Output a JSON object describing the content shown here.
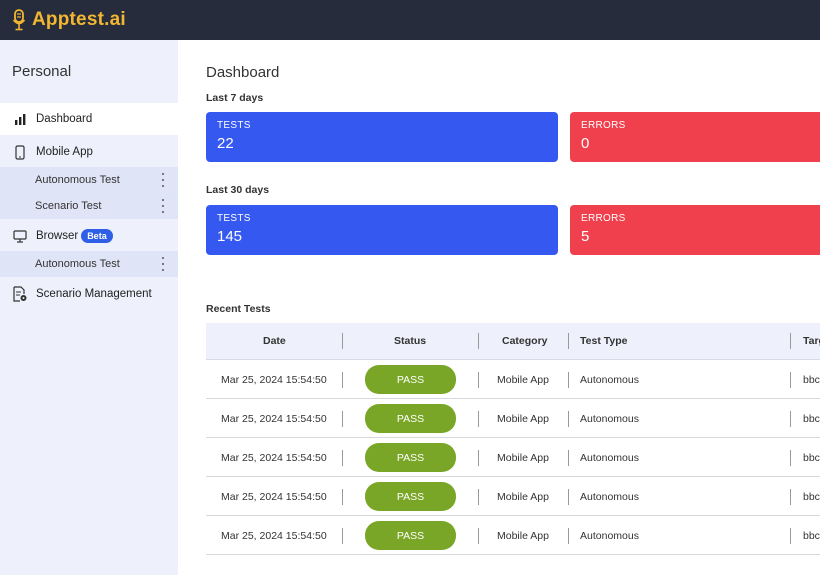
{
  "app": {
    "name": "Apptest.ai"
  },
  "sidebar": {
    "section_title": "Personal",
    "dashboard": "Dashboard",
    "mobile_app": "Mobile App",
    "mobile_sub": [
      "Autonomous Test",
      "Scenario Test"
    ],
    "browser": "Browser",
    "browser_badge": "Beta",
    "browser_sub": [
      "Autonomous Test"
    ],
    "scenario_management": "Scenario Management"
  },
  "main": {
    "title": "Dashboard",
    "last7": {
      "label": "Last 7 days",
      "tests_label": "TESTS",
      "tests_value": "22",
      "errors_label": "ERRORS",
      "errors_value": "0"
    },
    "last30": {
      "label": "Last 30 days",
      "tests_label": "TESTS",
      "tests_value": "145",
      "errors_label": "ERRORS",
      "errors_value": "5"
    },
    "recent_label": "Recent Tests",
    "table": {
      "headers": {
        "date": "Date",
        "status": "Status",
        "category": "Category",
        "test_type": "Test Type",
        "target": "Targ"
      },
      "rows": [
        {
          "date": "Mar 25, 2024 15:54:50",
          "status": "PASS",
          "category": "Mobile App",
          "test_type": "Autonomous",
          "target": "bbc"
        },
        {
          "date": "Mar 25, 2024 15:54:50",
          "status": "PASS",
          "category": "Mobile App",
          "test_type": "Autonomous",
          "target": "bbc"
        },
        {
          "date": "Mar 25, 2024 15:54:50",
          "status": "PASS",
          "category": "Mobile App",
          "test_type": "Autonomous",
          "target": "bbc"
        },
        {
          "date": "Mar 25, 2024 15:54:50",
          "status": "PASS",
          "category": "Mobile App",
          "test_type": "Autonomous",
          "target": "bbc"
        },
        {
          "date": "Mar 25, 2024 15:54:50",
          "status": "PASS",
          "category": "Mobile App",
          "test_type": "Autonomous",
          "target": "bbc"
        }
      ]
    }
  },
  "colors": {
    "topbar": "#262c3c",
    "brand": "#f2b632",
    "tests_card": "#3558f0",
    "errors_card": "#f0404d",
    "pass": "#7aa628"
  },
  "icons": {
    "logo": "microphone-logo-icon",
    "dashboard": "bar-chart-icon",
    "mobile": "phone-icon",
    "browser": "monitor-icon",
    "scenario": "document-gear-icon",
    "more": "kebab-icon"
  }
}
